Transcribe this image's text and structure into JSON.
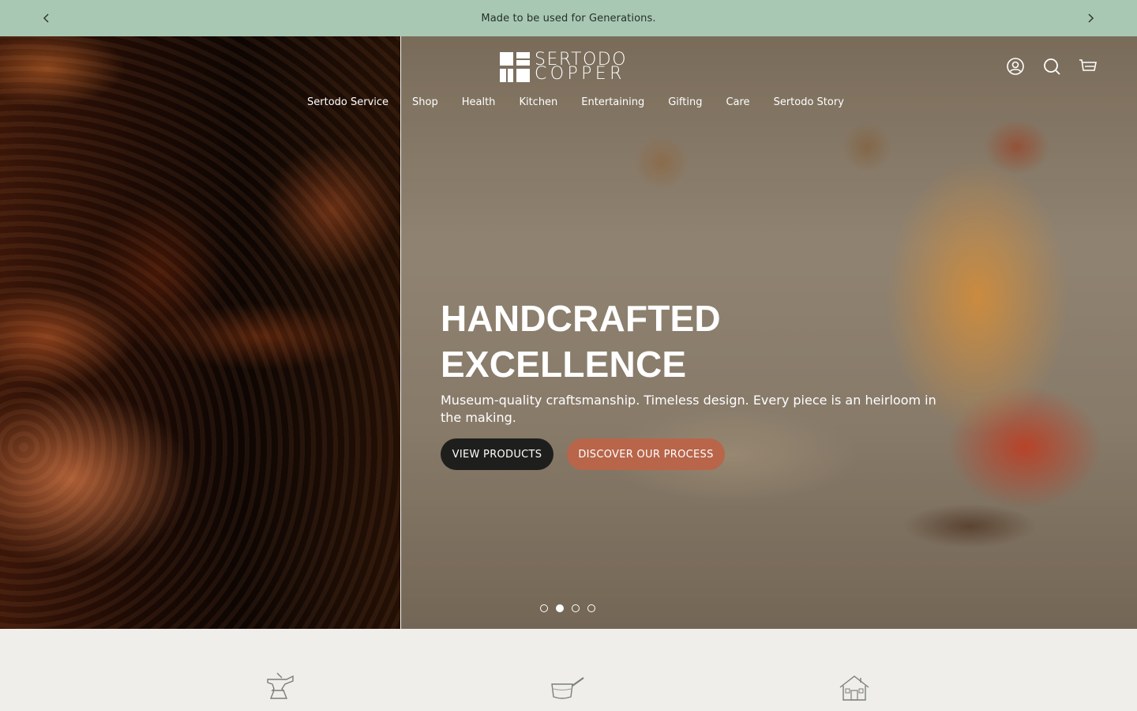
{
  "announcement": {
    "text": "Made to be used for Generations.",
    "prev_icon": "chevron-left-icon",
    "next_icon": "chevron-right-icon"
  },
  "header": {
    "logo_line1": "SERTODO",
    "logo_line2": "COPPER",
    "icons": [
      "account-icon",
      "search-icon",
      "cart-icon"
    ]
  },
  "nav": {
    "items": [
      "Sertodo Service",
      "Shop",
      "Health",
      "Kitchen",
      "Entertaining",
      "Gifting",
      "Care",
      "Sertodo Story"
    ]
  },
  "hero": {
    "title_line1": "HANDCRAFTED",
    "title_line2": "EXCELLENCE",
    "subtitle": "Museum-quality craftsmanship. Timeless design. Every piece is an heirloom in the making.",
    "primary_button": "VIEW PRODUCTS",
    "secondary_button": "DISCOVER OUR PROCESS",
    "slide_count": 4,
    "active_slide": 2
  },
  "features": {
    "icons": [
      "anvil-icon",
      "saucepan-icon",
      "workshop-house-icon"
    ]
  },
  "colors": {
    "announcement_bg": "#a9c8b3",
    "accent_button": "#b8654a",
    "dark_button": "#1e1f1d",
    "page_bg": "#efeeea"
  }
}
